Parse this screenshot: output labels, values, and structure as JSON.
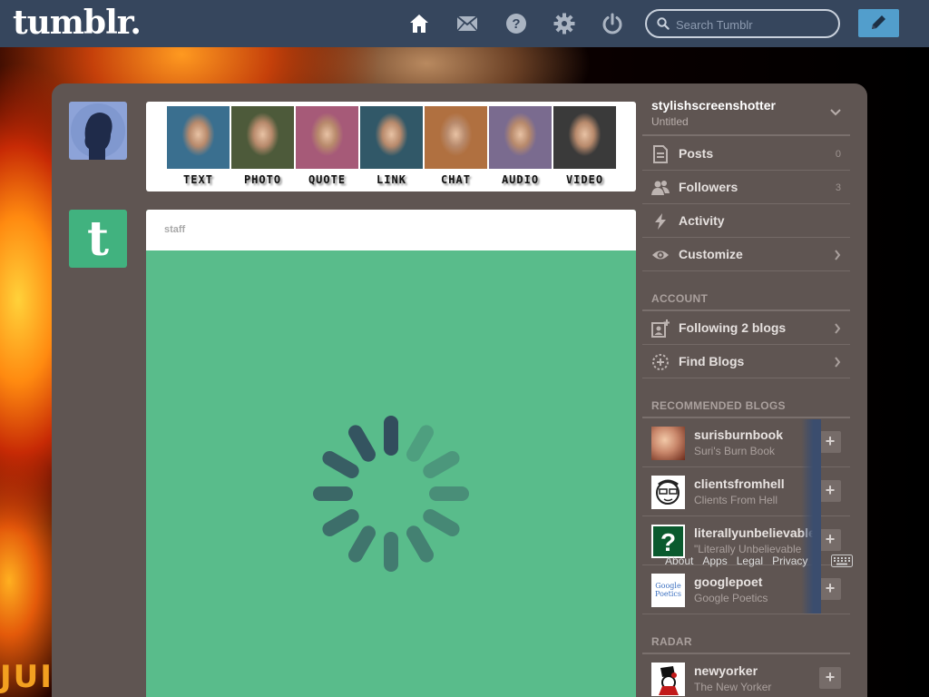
{
  "header": {
    "logo": "tumblr.",
    "search_placeholder": "Search Tumblr",
    "icons": [
      "home-icon",
      "mail-icon",
      "help-icon",
      "gear-icon",
      "power-icon"
    ]
  },
  "background": {
    "letters": "JUI"
  },
  "post_types": [
    {
      "label": "TEXT",
      "color": "#3a6f8f"
    },
    {
      "label": "PHOTO",
      "color": "#4d5a3a"
    },
    {
      "label": "QUOTE",
      "color": "#a65a78"
    },
    {
      "label": "LINK",
      "color": "#315868"
    },
    {
      "label": "CHAT",
      "color": "#b07040"
    },
    {
      "label": "AUDIO",
      "color": "#7a6b8f"
    },
    {
      "label": "VIDEO",
      "color": "#3a3a3a"
    }
  ],
  "post": {
    "author": "staff",
    "background_color": "#59bc8b"
  },
  "account": {
    "name": "stylishscreenshotter",
    "subtitle": "Untitled",
    "items": [
      {
        "label": "Posts",
        "count": "0",
        "icon": "posts-icon"
      },
      {
        "label": "Followers",
        "count": "3",
        "icon": "followers-icon"
      },
      {
        "label": "Activity",
        "icon": "bolt-icon"
      },
      {
        "label": "Customize",
        "icon": "eye-icon",
        "chevron": true
      }
    ]
  },
  "account_section": {
    "title": "ACCOUNT",
    "items": [
      {
        "label": "Following 2 blogs",
        "icon": "following-icon"
      },
      {
        "label": "Find Blogs",
        "icon": "find-blogs-icon"
      }
    ]
  },
  "recommended": {
    "title": "RECOMMENDED BLOGS",
    "blogs": [
      {
        "name": "surisburnbook",
        "title": "Suri's Burn Book"
      },
      {
        "name": "clientsfromhell",
        "title": "Clients From Hell"
      },
      {
        "name": "literallyunbelievable",
        "title": "\"Literally Unbelievable"
      },
      {
        "name": "googlepoet",
        "title": "Google Poetics",
        "avatar_text": "Google Poetics"
      }
    ]
  },
  "footer_links": [
    "About",
    "Apps",
    "Legal",
    "Privacy"
  ],
  "radar": {
    "title": "RADAR",
    "blogs": [
      {
        "name": "newyorker",
        "title": "The New Yorker"
      }
    ]
  },
  "colors": {
    "header_bg": "#36465d",
    "container_bg": "#5f5552",
    "compose_button": "#529ecc",
    "staff_green": "#41b27f"
  }
}
